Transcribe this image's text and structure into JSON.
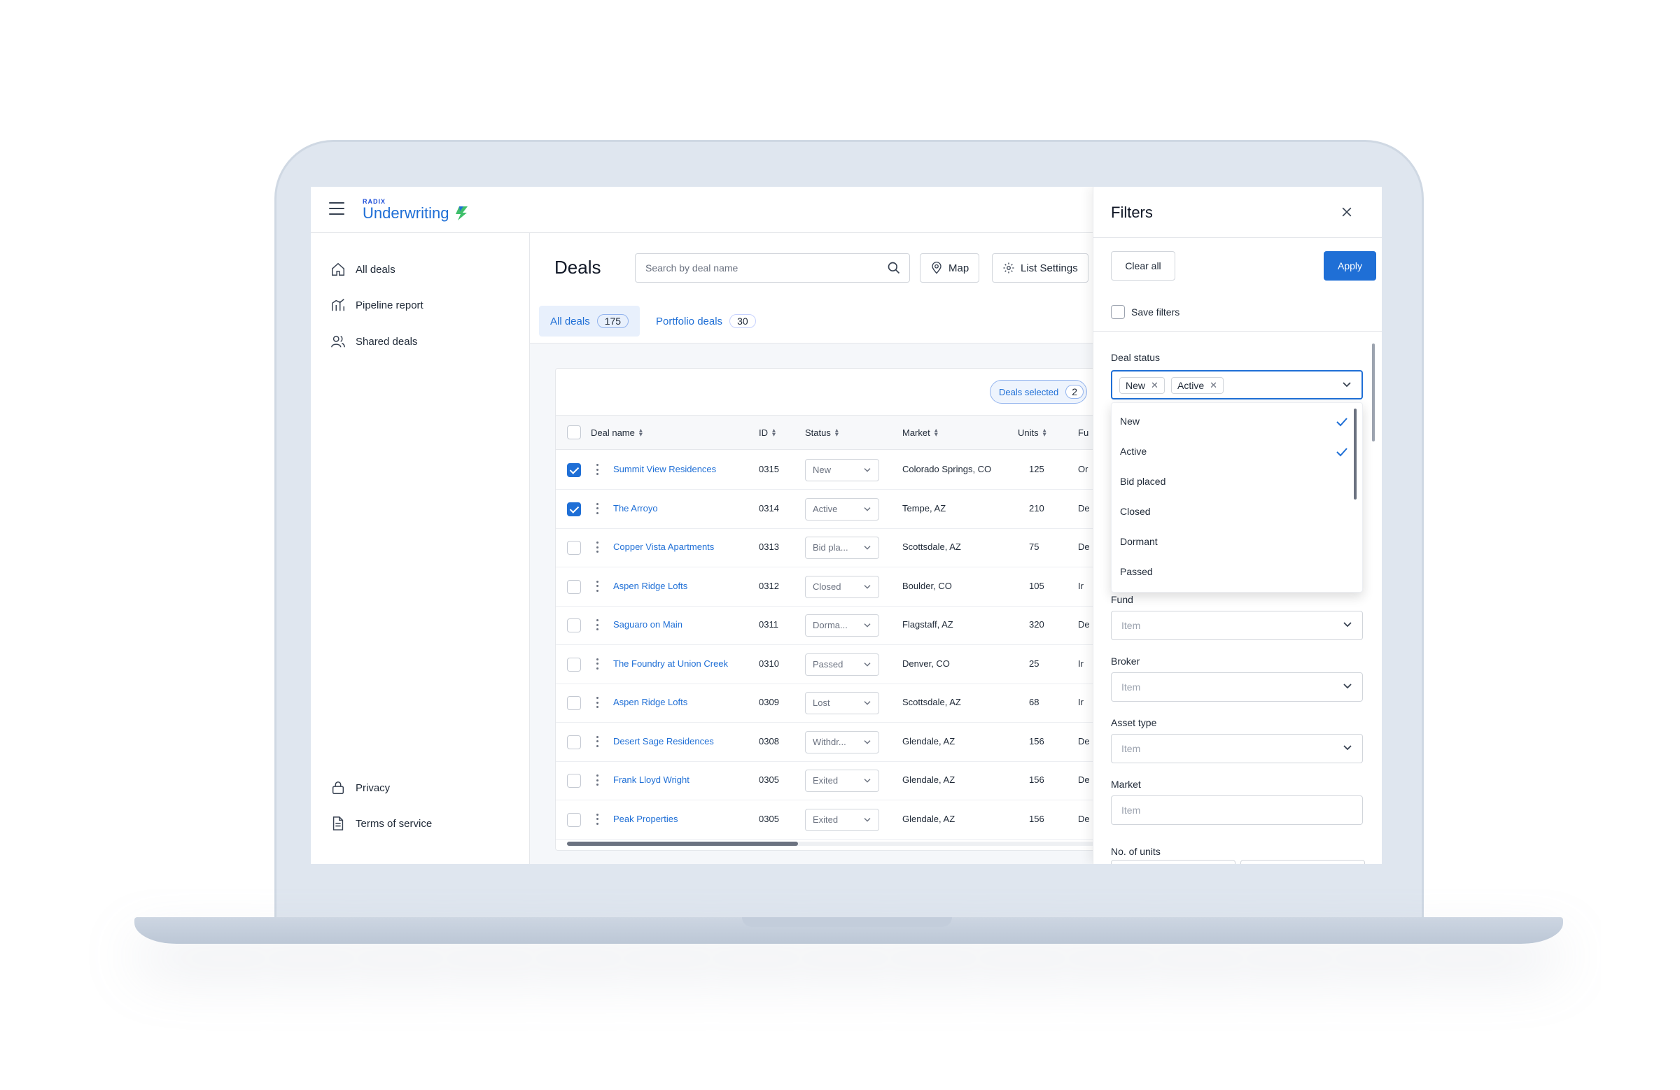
{
  "app": {
    "logo_small": "RADIX",
    "logo_main": "Underwriting"
  },
  "sidebar": {
    "items": [
      {
        "label": "All deals",
        "icon": "home-icon"
      },
      {
        "label": "Pipeline report",
        "icon": "chart-icon"
      },
      {
        "label": "Shared deals",
        "icon": "users-icon"
      }
    ],
    "footer": [
      {
        "label": "Privacy",
        "icon": "lock-icon"
      },
      {
        "label": "Terms of service",
        "icon": "document-icon"
      }
    ]
  },
  "main": {
    "title": "Deals",
    "search_placeholder": "Search by deal name",
    "map_label": "Map",
    "list_settings_label": "List Settings",
    "tabs": [
      {
        "label": "All deals",
        "count": "175"
      },
      {
        "label": "Portfolio deals",
        "count": "30"
      }
    ],
    "deals_selected_label": "Deals selected",
    "deals_selected_count": "2"
  },
  "table": {
    "columns": [
      "Deal name",
      "ID",
      "Status",
      "Market",
      "Units",
      "Fu"
    ],
    "rows": [
      {
        "name": "Summit View Residences",
        "id": "0315",
        "status": "New",
        "market": "Colorado Springs, CO",
        "units": "125",
        "fund": "Or",
        "checked": true
      },
      {
        "name": "The Arroyo",
        "id": "0314",
        "status": "Active",
        "market": "Tempe, AZ",
        "units": "210",
        "fund": "De",
        "checked": true
      },
      {
        "name": "Copper Vista Apartments",
        "id": "0313",
        "status": "Bid pla...",
        "market": "Scottsdale, AZ",
        "units": "75",
        "fund": "De",
        "checked": false
      },
      {
        "name": "Aspen Ridge Lofts",
        "id": "0312",
        "status": "Closed",
        "market": "Boulder, CO",
        "units": "105",
        "fund": "Ir",
        "checked": false
      },
      {
        "name": "Saguaro on Main",
        "id": "0311",
        "status": "Dorma...",
        "market": "Flagstaff, AZ",
        "units": "320",
        "fund": "De",
        "checked": false
      },
      {
        "name": "The Foundry at Union Creek",
        "id": "0310",
        "status": "Passed",
        "market": "Denver, CO",
        "units": "25",
        "fund": "Ir",
        "checked": false
      },
      {
        "name": "Aspen Ridge Lofts",
        "id": "0309",
        "status": "Lost",
        "market": "Scottsdale, AZ",
        "units": "68",
        "fund": "Ir",
        "checked": false
      },
      {
        "name": "Desert Sage Residences",
        "id": "0308",
        "status": "Withdr...",
        "market": "Glendale, AZ",
        "units": "156",
        "fund": "De",
        "checked": false
      },
      {
        "name": "Frank Lloyd Wright",
        "id": "0305",
        "status": "Exited",
        "market": "Glendale, AZ",
        "units": "156",
        "fund": "De",
        "checked": false
      },
      {
        "name": "Peak Properties",
        "id": "0305",
        "status": "Exited",
        "market": "Glendale, AZ",
        "units": "156",
        "fund": "De",
        "checked": false
      }
    ]
  },
  "filters": {
    "title": "Filters",
    "clear_all": "Clear all",
    "apply": "Apply",
    "save_filters": "Save filters",
    "deal_status_label": "Deal status",
    "selected_chips": [
      "New",
      "Active"
    ],
    "status_options": [
      {
        "label": "New",
        "selected": true
      },
      {
        "label": "Active",
        "selected": true
      },
      {
        "label": "Bid placed",
        "selected": false
      },
      {
        "label": "Closed",
        "selected": false
      },
      {
        "label": "Dormant",
        "selected": false
      },
      {
        "label": "Passed",
        "selected": false
      }
    ],
    "fund_label": "Fund",
    "broker_label": "Broker",
    "asset_type_label": "Asset type",
    "market_label": "Market",
    "units_label": "No. of units",
    "item_placeholder": "Item"
  },
  "colors": {
    "accent": "#1f6fd6",
    "laptop": "#dfe6ef"
  }
}
